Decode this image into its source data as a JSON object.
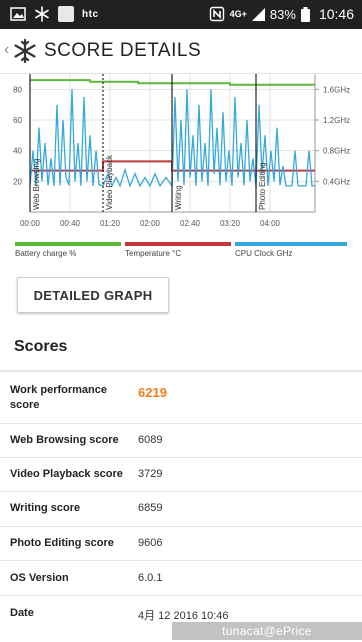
{
  "status_bar": {
    "carrier": "htc",
    "network": "4G+",
    "battery": "83%",
    "time": "10:46"
  },
  "header": {
    "back": "‹",
    "title": "SCORE DETAILS"
  },
  "chart_data": {
    "type": "line",
    "x_ticks": [
      "00:00",
      "00:40",
      "01:20",
      "02:00",
      "02:40",
      "03:20",
      "04:00"
    ],
    "y_left_ticks": [
      "80",
      "60",
      "40",
      "20"
    ],
    "y_right_ticks": [
      "1.6GHz",
      "1.2GHz",
      "0.8GHz",
      "0.4GHz"
    ],
    "ylim_left": [
      0,
      90
    ],
    "ylim_right": [
      0,
      1.8
    ],
    "xlim_seconds": [
      0,
      285
    ],
    "section_labels": [
      "Web Browsing",
      "Video Playback",
      "Writing",
      "Photo Editing"
    ],
    "section_starts_seconds": [
      0,
      73,
      142,
      226
    ],
    "series": [
      {
        "name": "Battery charge %",
        "color": "#5cb83c",
        "points": [
          [
            0,
            86
          ],
          [
            60,
            86
          ],
          [
            60,
            85
          ],
          [
            108,
            85
          ],
          [
            108,
            84
          ],
          [
            200,
            84
          ],
          [
            200,
            83
          ],
          [
            285,
            83
          ]
        ]
      },
      {
        "name": "Temperature °C",
        "color": "#c0393b",
        "points": [
          [
            0,
            27
          ],
          [
            73,
            27
          ],
          [
            73,
            33
          ],
          [
            142,
            33
          ],
          [
            142,
            27
          ],
          [
            285,
            27
          ]
        ]
      },
      {
        "name": "CPU Clock GHz",
        "color": "#35a9dc",
        "points": [
          [
            0,
            0.34
          ],
          [
            3,
            0.8
          ],
          [
            6,
            0.34
          ],
          [
            9,
            1.1
          ],
          [
            12,
            0.4
          ],
          [
            15,
            0.9
          ],
          [
            18,
            0.35
          ],
          [
            21,
            0.7
          ],
          [
            24,
            0.34
          ],
          [
            27,
            1.4
          ],
          [
            30,
            0.35
          ],
          [
            33,
            1.2
          ],
          [
            36,
            0.45
          ],
          [
            39,
            0.35
          ],
          [
            42,
            1.6
          ],
          [
            45,
            0.4
          ],
          [
            48,
            0.9
          ],
          [
            51,
            0.34
          ],
          [
            54,
            1.5
          ],
          [
            57,
            0.4
          ],
          [
            60,
            1.0
          ],
          [
            63,
            0.34
          ],
          [
            66,
            0.8
          ],
          [
            69,
            0.36
          ],
          [
            73,
            0.34
          ],
          [
            78,
            0.5
          ],
          [
            82,
            0.34
          ],
          [
            86,
            0.45
          ],
          [
            90,
            0.34
          ],
          [
            95,
            0.55
          ],
          [
            100,
            0.34
          ],
          [
            105,
            0.5
          ],
          [
            110,
            0.34
          ],
          [
            115,
            0.45
          ],
          [
            120,
            0.34
          ],
          [
            125,
            0.5
          ],
          [
            130,
            0.34
          ],
          [
            136,
            0.45
          ],
          [
            142,
            0.34
          ],
          [
            145,
            1.5
          ],
          [
            148,
            0.4
          ],
          [
            151,
            1.2
          ],
          [
            154,
            0.35
          ],
          [
            157,
            1.6
          ],
          [
            160,
            0.45
          ],
          [
            163,
            1.0
          ],
          [
            166,
            0.34
          ],
          [
            169,
            1.4
          ],
          [
            172,
            0.4
          ],
          [
            175,
            0.9
          ],
          [
            178,
            0.34
          ],
          [
            181,
            1.6
          ],
          [
            184,
            0.5
          ],
          [
            187,
            1.1
          ],
          [
            190,
            0.35
          ],
          [
            193,
            1.3
          ],
          [
            196,
            0.4
          ],
          [
            199,
            0.8
          ],
          [
            202,
            0.34
          ],
          [
            205,
            1.5
          ],
          [
            208,
            0.45
          ],
          [
            211,
            0.9
          ],
          [
            214,
            0.35
          ],
          [
            217,
            1.2
          ],
          [
            220,
            0.4
          ],
          [
            223,
            0.7
          ],
          [
            226,
            0.34
          ],
          [
            229,
            1.4
          ],
          [
            232,
            0.5
          ],
          [
            235,
            1.0
          ],
          [
            238,
            0.34
          ],
          [
            241,
            0.8
          ],
          [
            244,
            0.4
          ],
          [
            247,
            1.1
          ],
          [
            250,
            0.35
          ],
          [
            253,
            0.6
          ],
          [
            256,
            0.34
          ],
          [
            262,
            0.34
          ],
          [
            265,
            0.8
          ],
          [
            268,
            0.34
          ],
          [
            272,
            0.34
          ],
          [
            276,
            0.34
          ],
          [
            279,
            0.8
          ],
          [
            282,
            0.34
          ],
          [
            285,
            0.34
          ]
        ]
      }
    ]
  },
  "legend": {
    "battery": "Battery charge %",
    "temperature": "Temperature °C",
    "cpu": "CPU Clock GHz"
  },
  "detailed_graph_label": "DETAILED GRAPH",
  "scores": {
    "heading": "Scores",
    "rows": [
      {
        "label": "Work performance score",
        "value": "6219"
      },
      {
        "label": "Web Browsing score",
        "value": "6089"
      },
      {
        "label": "Video Playback score",
        "value": "3729"
      },
      {
        "label": "Writing score",
        "value": "6859"
      },
      {
        "label": "Photo Editing score",
        "value": "9606"
      },
      {
        "label": "OS Version",
        "value": "6.0.1"
      },
      {
        "label": "Date",
        "value": "4月 12 2016 10:46"
      }
    ]
  },
  "watermark": "tunacat@ePrice",
  "colors": {
    "accent_orange": "#f07f1a",
    "battery_green": "#5cb83c",
    "temperature_red": "#c0393b",
    "cpu_blue": "#35a9dc",
    "status_bar": "#212121"
  }
}
